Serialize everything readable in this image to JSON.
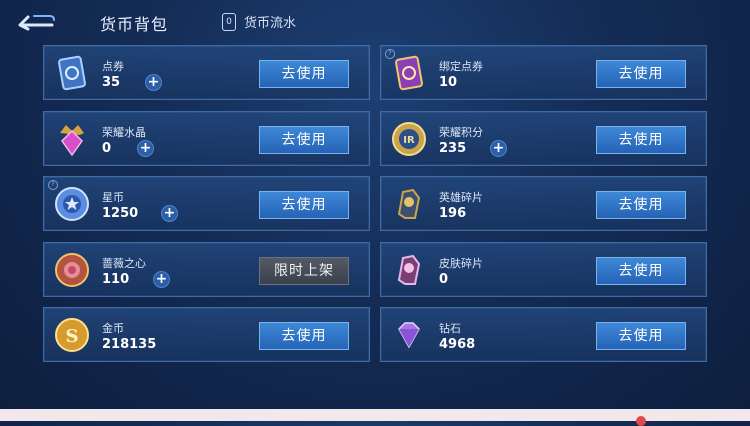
{
  "header": {
    "title": "货币背包",
    "flow_label": "货币流水",
    "flow_icon_glyph": "0"
  },
  "cards": [
    {
      "name": "点券",
      "amount": "35",
      "button": "去使用",
      "icon": "voucher-card-icon",
      "has_plus": true,
      "has_info": false
    },
    {
      "name": "绑定点券",
      "amount": "10",
      "button": "去使用",
      "icon": "bound-voucher-card-icon",
      "has_plus": false,
      "has_info": true
    },
    {
      "name": "荣耀水晶",
      "amount": "0",
      "button": "去使用",
      "icon": "glory-crystal-icon",
      "has_plus": true,
      "has_info": false
    },
    {
      "name": "荣耀积分",
      "amount": "235",
      "button": "去使用",
      "icon": "glory-points-icon",
      "has_plus": true,
      "has_info": false
    },
    {
      "name": "星币",
      "amount": "1250",
      "button": "去使用",
      "icon": "star-coin-icon",
      "has_plus": true,
      "has_info": true
    },
    {
      "name": "英雄碎片",
      "amount": "196",
      "button": "去使用",
      "icon": "hero-fragment-icon",
      "has_plus": false,
      "has_info": false
    },
    {
      "name": "蔷薇之心",
      "amount": "110",
      "button": "限时上架",
      "icon": "rose-heart-icon",
      "has_plus": true,
      "has_info": false,
      "disabled": true
    },
    {
      "name": "皮肤碎片",
      "amount": "0",
      "button": "去使用",
      "icon": "skin-fragment-icon",
      "has_plus": false,
      "has_info": false
    },
    {
      "name": "金币",
      "amount": "218135",
      "button": "去使用",
      "icon": "gold-coin-icon",
      "has_plus": false,
      "has_info": false
    },
    {
      "name": "钻石",
      "amount": "4968",
      "button": "去使用",
      "icon": "diamond-icon",
      "has_plus": false,
      "has_info": false
    }
  ],
  "colors": {
    "accent_button": "#2f74c8",
    "disabled_button": "#474c56",
    "card_border": "#3e6aa6",
    "background": "#142c55"
  }
}
